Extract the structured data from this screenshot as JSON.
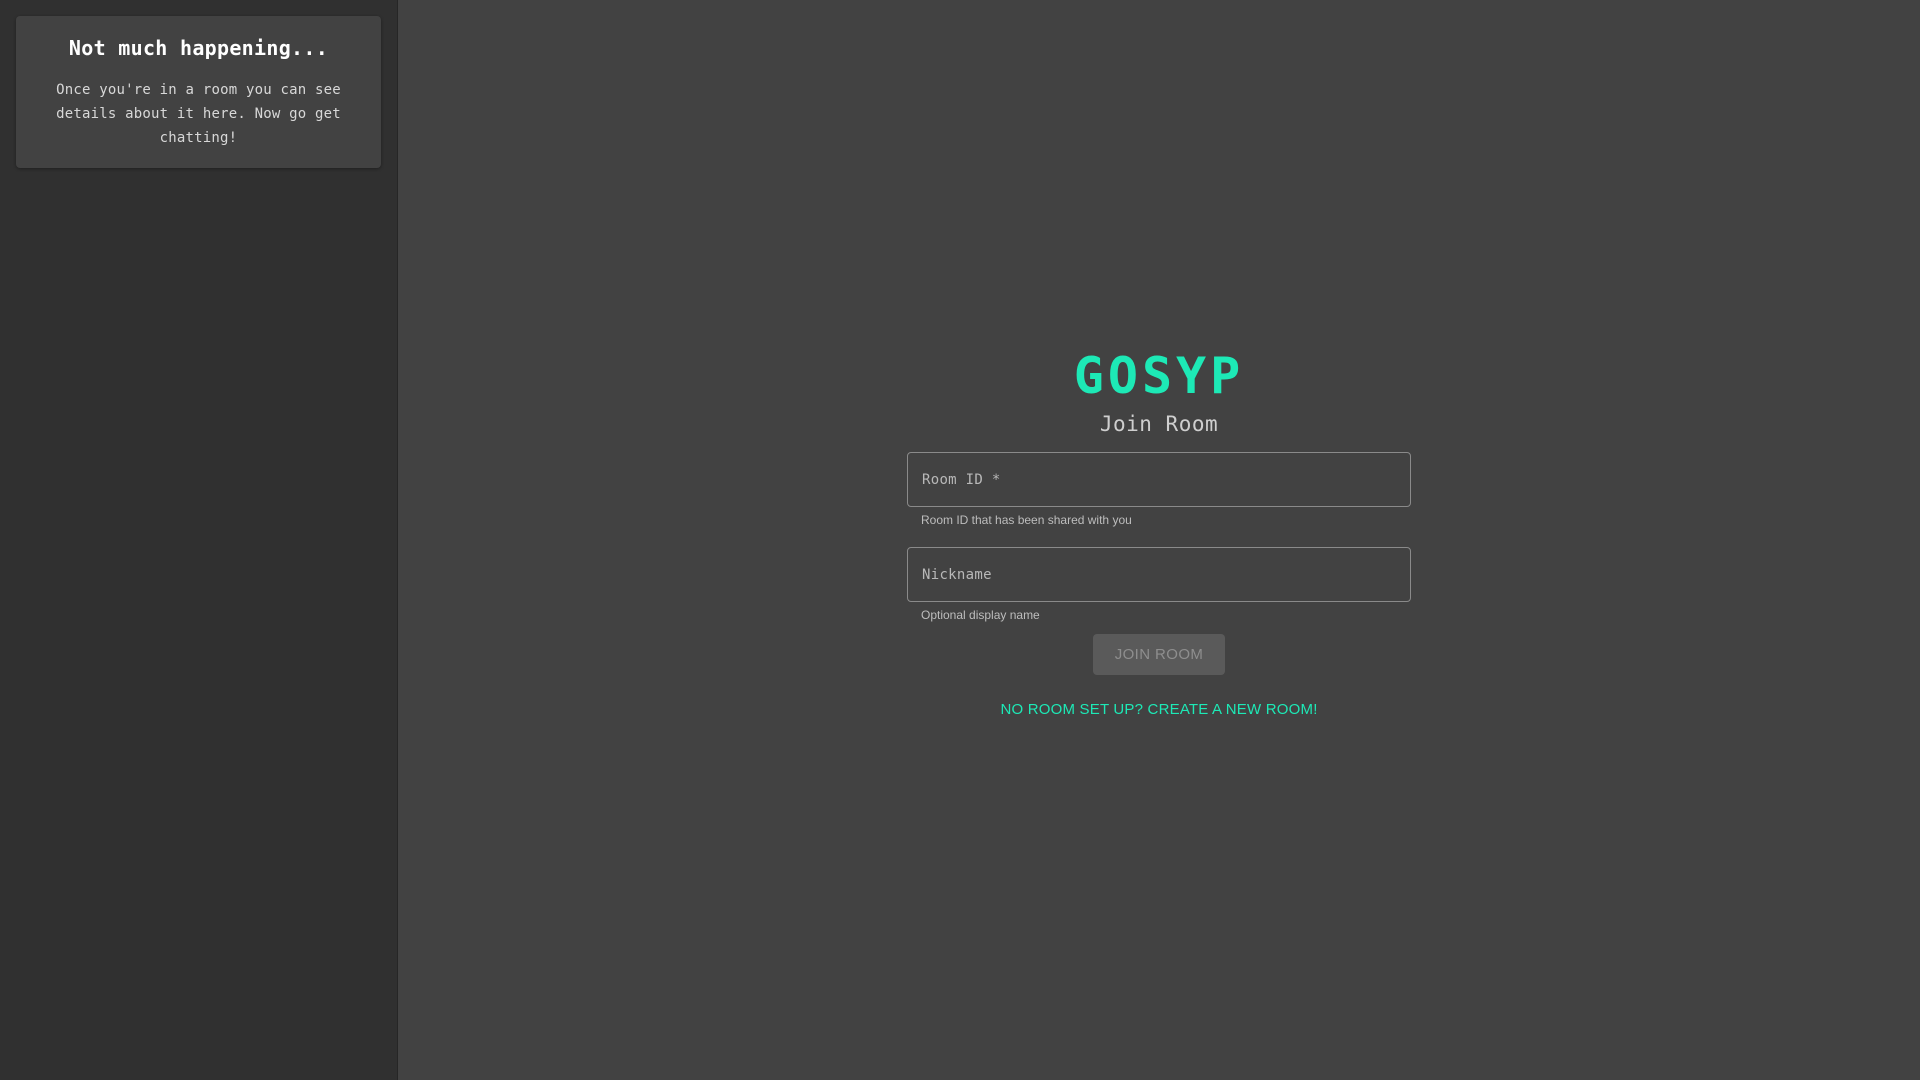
{
  "sidebar": {
    "card": {
      "title": "Not much happening...",
      "text": "Once you're in a room you can see details about it here. Now go get chatting!"
    }
  },
  "main": {
    "brand": "GOSYP",
    "subtitle": "Join Room",
    "room_id_field": {
      "label": "Room ID",
      "required_mark": "*",
      "value": "",
      "helper": "Room ID that has been shared with you"
    },
    "nickname_field": {
      "label": "Nickname",
      "value": "",
      "helper": "Optional display name"
    },
    "join_button_label": "JOIN ROOM",
    "create_link_label": "NO ROOM SET UP? CREATE A NEW ROOM!"
  },
  "colors": {
    "accent": "#1de9b6",
    "background": "#424242",
    "sidebar": "#303030"
  }
}
